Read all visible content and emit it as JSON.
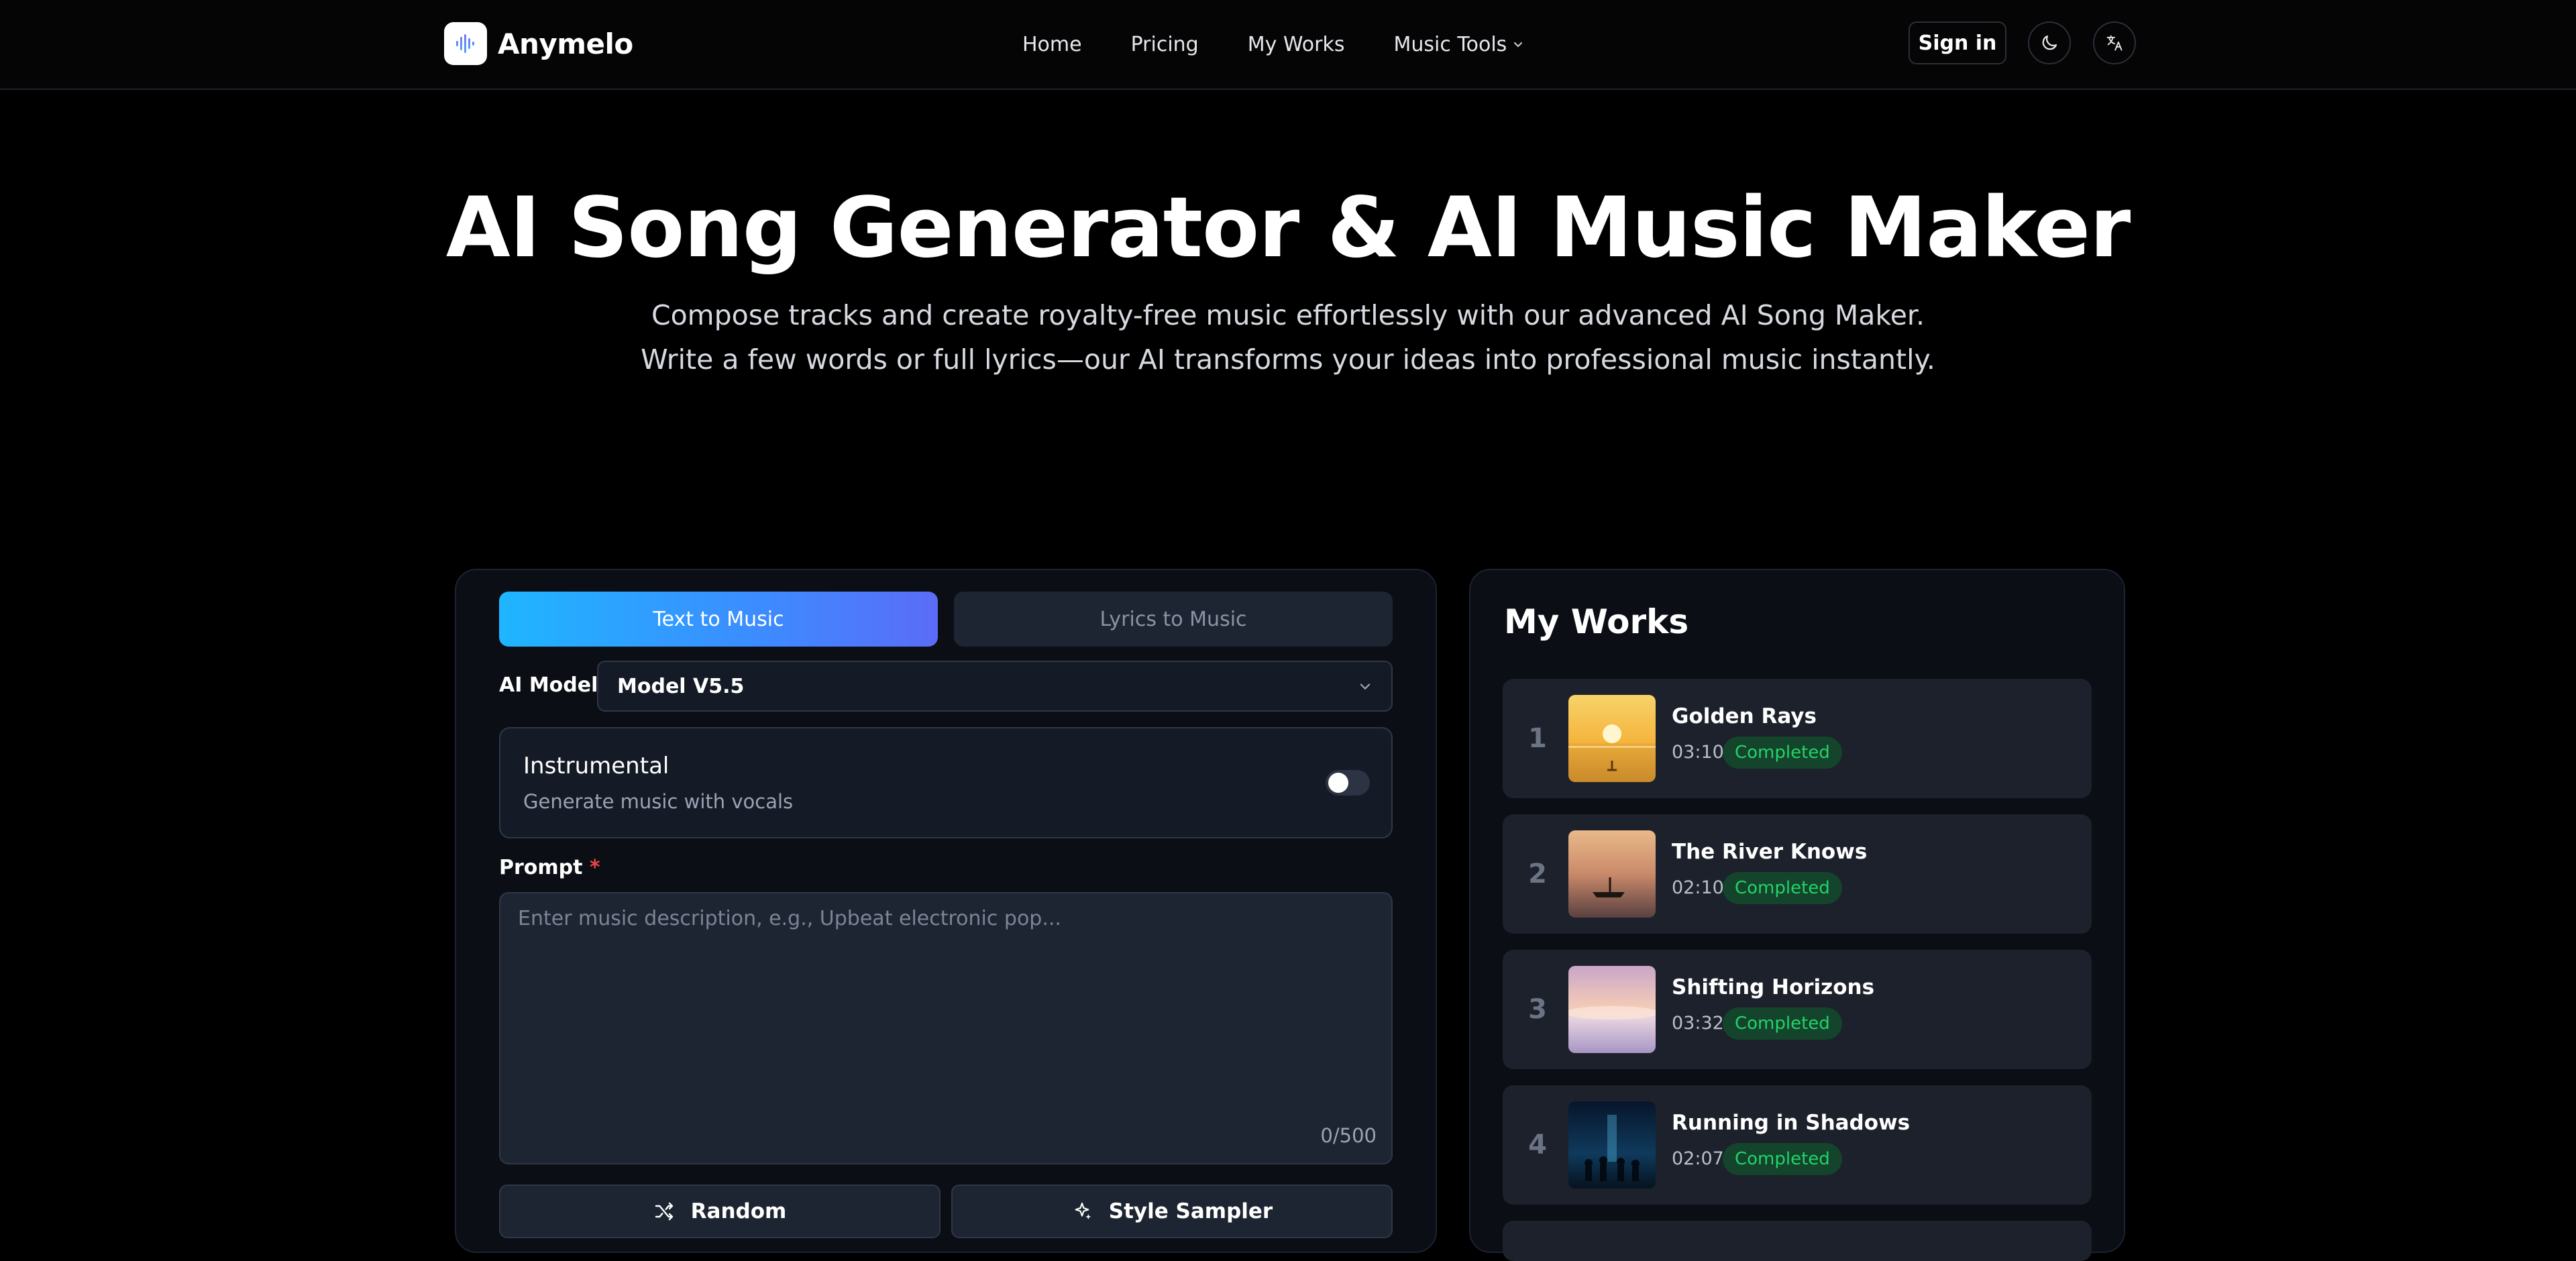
{
  "nav": {
    "brand": "Anymelo",
    "links": [
      {
        "label": "Home"
      },
      {
        "label": "Pricing"
      },
      {
        "label": "My Works"
      },
      {
        "label": "Music Tools"
      }
    ],
    "sign_in": "Sign in",
    "theme_icon": "moon-icon",
    "language_icon": "translate-icon"
  },
  "hero": {
    "title": "AI Song Generator & AI Music Maker",
    "subtitle_line1": "Compose tracks and create royalty-free music effortlessly with our advanced AI Song Maker.",
    "subtitle_line2": "Write a few words or full lyrics—our AI transforms your ideas into professional music instantly."
  },
  "generator": {
    "tabs": [
      {
        "label": "Text to Music",
        "active": true
      },
      {
        "label": "Lyrics to Music",
        "active": false
      }
    ],
    "model_label": "AI Model",
    "model_value": "Model V5.5",
    "instrumental": {
      "title": "Instrumental",
      "description": "Generate music with vocals",
      "enabled": false
    },
    "prompt_label": "Prompt",
    "prompt_required_mark": "*",
    "prompt_placeholder": "Enter music description, e.g., Upbeat electronic pop...",
    "prompt_value": "",
    "char_count": "0/500",
    "random_label": "Random",
    "style_sampler_label": "Style Sampler"
  },
  "works": {
    "title": "My Works",
    "items": [
      {
        "index": "1",
        "title": "Golden Rays",
        "duration": "03:10",
        "status": "Completed"
      },
      {
        "index": "2",
        "title": "The River Knows",
        "duration": "02:10",
        "status": "Completed"
      },
      {
        "index": "3",
        "title": "Shifting Horizons",
        "duration": "03:32",
        "status": "Completed"
      },
      {
        "index": "4",
        "title": "Running in Shadows",
        "duration": "02:07",
        "status": "Completed"
      }
    ]
  },
  "colors": {
    "background": "#000000",
    "panel": "#0b0e14",
    "accent_gradient_start": "#1fb6ff",
    "accent_gradient_end": "#5b6cf7",
    "status_green": "#22d36a"
  }
}
